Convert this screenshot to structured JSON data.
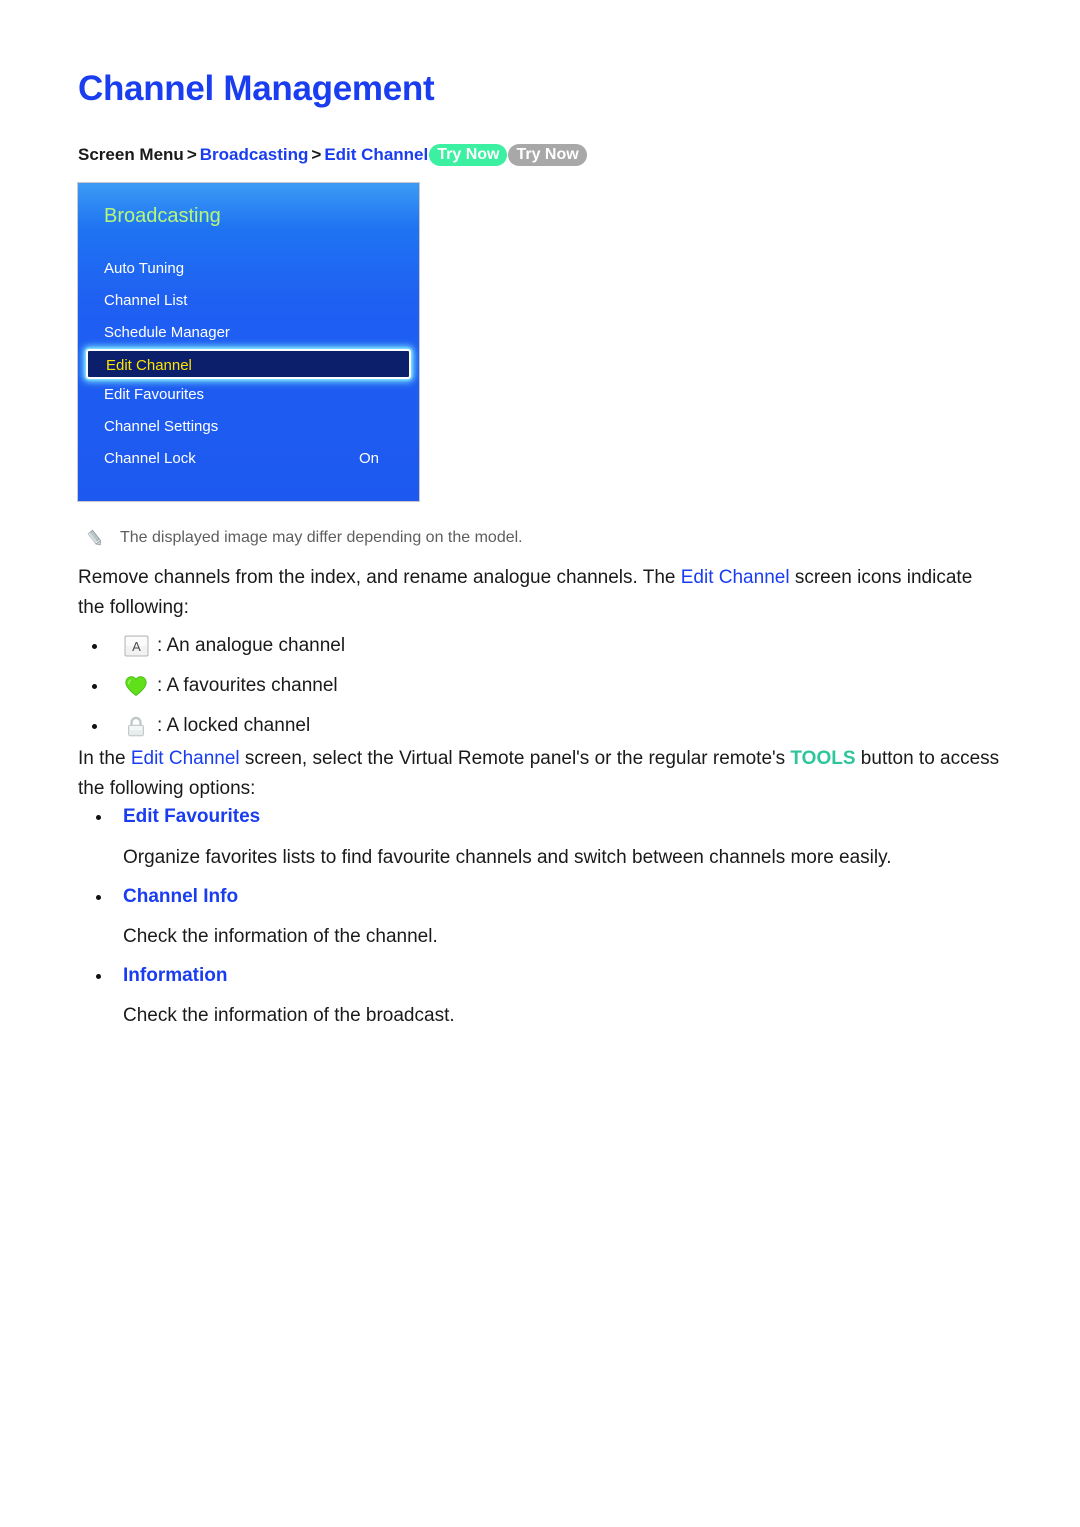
{
  "title": "Channel Management",
  "breadcrumb": {
    "root": "Screen Menu",
    "sep1": ">",
    "level1": "Broadcasting",
    "sep2": ">",
    "level2": "Edit Channel",
    "badge_green": "Try Now",
    "badge_grey": "Try Now"
  },
  "tv_panel": {
    "title": "Broadcasting",
    "items": [
      {
        "label": "Auto Tuning",
        "value": "",
        "selected": false
      },
      {
        "label": "Channel List",
        "value": "",
        "selected": false
      },
      {
        "label": "Schedule Manager",
        "value": "",
        "selected": false
      },
      {
        "label": "Edit Channel",
        "value": "",
        "selected": true
      },
      {
        "label": "Edit Favourites",
        "value": "",
        "selected": false
      },
      {
        "label": "Channel Settings",
        "value": "",
        "selected": false
      },
      {
        "label": "Channel Lock",
        "value": "On",
        "selected": false
      }
    ]
  },
  "note": {
    "icon": "pencil-icon",
    "text": "The displayed image may differ depending on the model."
  },
  "intro": {
    "part1": "Remove channels from the index, and rename analogue channels. The ",
    "link": "Edit Channel",
    "part2": " screen icons indicate the following:"
  },
  "icon_legend": [
    {
      "icon": "analogue-channel-icon",
      "glyph": "A",
      "caption": ": An analogue channel"
    },
    {
      "icon": "favourites-heart-icon",
      "glyph": "",
      "caption": ": A favourites channel"
    },
    {
      "icon": "locked-channel-icon",
      "glyph": "",
      "caption": ": A locked channel"
    }
  ],
  "tools_para": {
    "part1": "In the ",
    "link": "Edit Channel",
    "part2": " screen, select the Virtual Remote panel's or the regular remote's ",
    "tools": "TOOLS",
    "part3": " button to access the following options:"
  },
  "options": [
    {
      "title": "Edit Favourites",
      "desc": "Organize favorites lists to find favourite channels and switch between channels more easily."
    },
    {
      "title": "Channel Info",
      "desc": "Check the information of the channel."
    },
    {
      "title": "Information",
      "desc": "Check the information of the broadcast."
    }
  ],
  "colors": {
    "link": "#1a3df0",
    "tools": "#2ec59d",
    "badge_green": "#3bf0a0",
    "badge_grey": "#a8a8a8",
    "panel_title": "#b5f77a",
    "selected_text": "#ffe400",
    "selected_bg": "#0b1f6b"
  }
}
